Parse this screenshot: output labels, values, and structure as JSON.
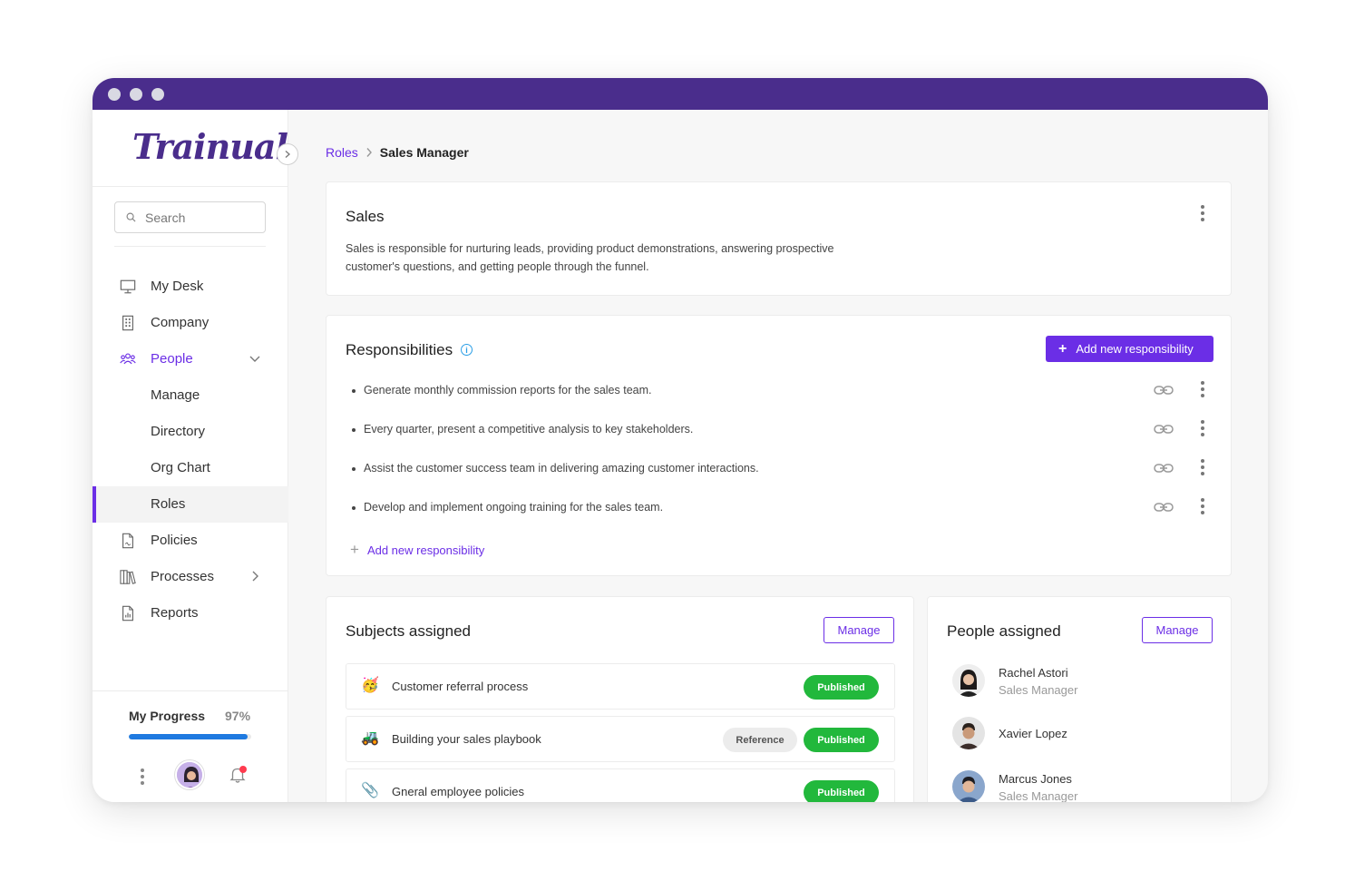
{
  "app": {
    "logo_text": "Trainual",
    "brand_color": "#4a2d8c",
    "accent_color": "#6b2ee6"
  },
  "sidebar": {
    "search_placeholder": "Search",
    "items": [
      {
        "label": "My Desk",
        "icon": "monitor-icon"
      },
      {
        "label": "Company",
        "icon": "building-icon"
      },
      {
        "label": "People",
        "icon": "people-icon"
      },
      {
        "label": "Manage",
        "icon": ""
      },
      {
        "label": "Directory",
        "icon": ""
      },
      {
        "label": "Org Chart",
        "icon": ""
      },
      {
        "label": "Roles",
        "icon": ""
      },
      {
        "label": "Policies",
        "icon": "document-icon"
      },
      {
        "label": "Processes",
        "icon": "books-icon"
      },
      {
        "label": "Reports",
        "icon": "report-icon"
      }
    ],
    "progress_label": "My Progress",
    "progress_value": "97%",
    "progress_fraction": 0.97
  },
  "breadcrumb": {
    "parent": "Roles",
    "current": "Sales Manager"
  },
  "role_card": {
    "title": "Sales",
    "description": "Sales is responsible for nurturing leads, providing product demonstrations, answering prospective customer's questions, and getting people through the funnel."
  },
  "responsibilities": {
    "title": "Responsibilities",
    "add_button": "Add new responsibility",
    "items": [
      "Generate monthly commission reports for the sales team.",
      "Every quarter, present a competitive analysis to key stakeholders.",
      "Assist the customer success team in delivering amazing customer interactions.",
      "Develop and implement ongoing training for the sales team."
    ],
    "add_link": "Add new responsibility"
  },
  "subjects": {
    "title": "Subjects assigned",
    "manage_button": "Manage",
    "items": [
      {
        "emoji": "🥳",
        "title": "Customer referral process",
        "badges": [
          "Published"
        ]
      },
      {
        "emoji": "🚜",
        "title": "Building your sales playbook",
        "badges": [
          "Reference",
          "Published"
        ]
      },
      {
        "emoji": "📎",
        "title": "Gneral employee policies",
        "badges": [
          "Published"
        ]
      }
    ]
  },
  "people": {
    "title": "People assigned",
    "manage_button": "Manage",
    "items": [
      {
        "name": "Rachel Astori",
        "role": "Sales Manager"
      },
      {
        "name": "Xavier Lopez",
        "role": ""
      },
      {
        "name": "Marcus Jones",
        "role": "Sales Manager"
      }
    ]
  }
}
